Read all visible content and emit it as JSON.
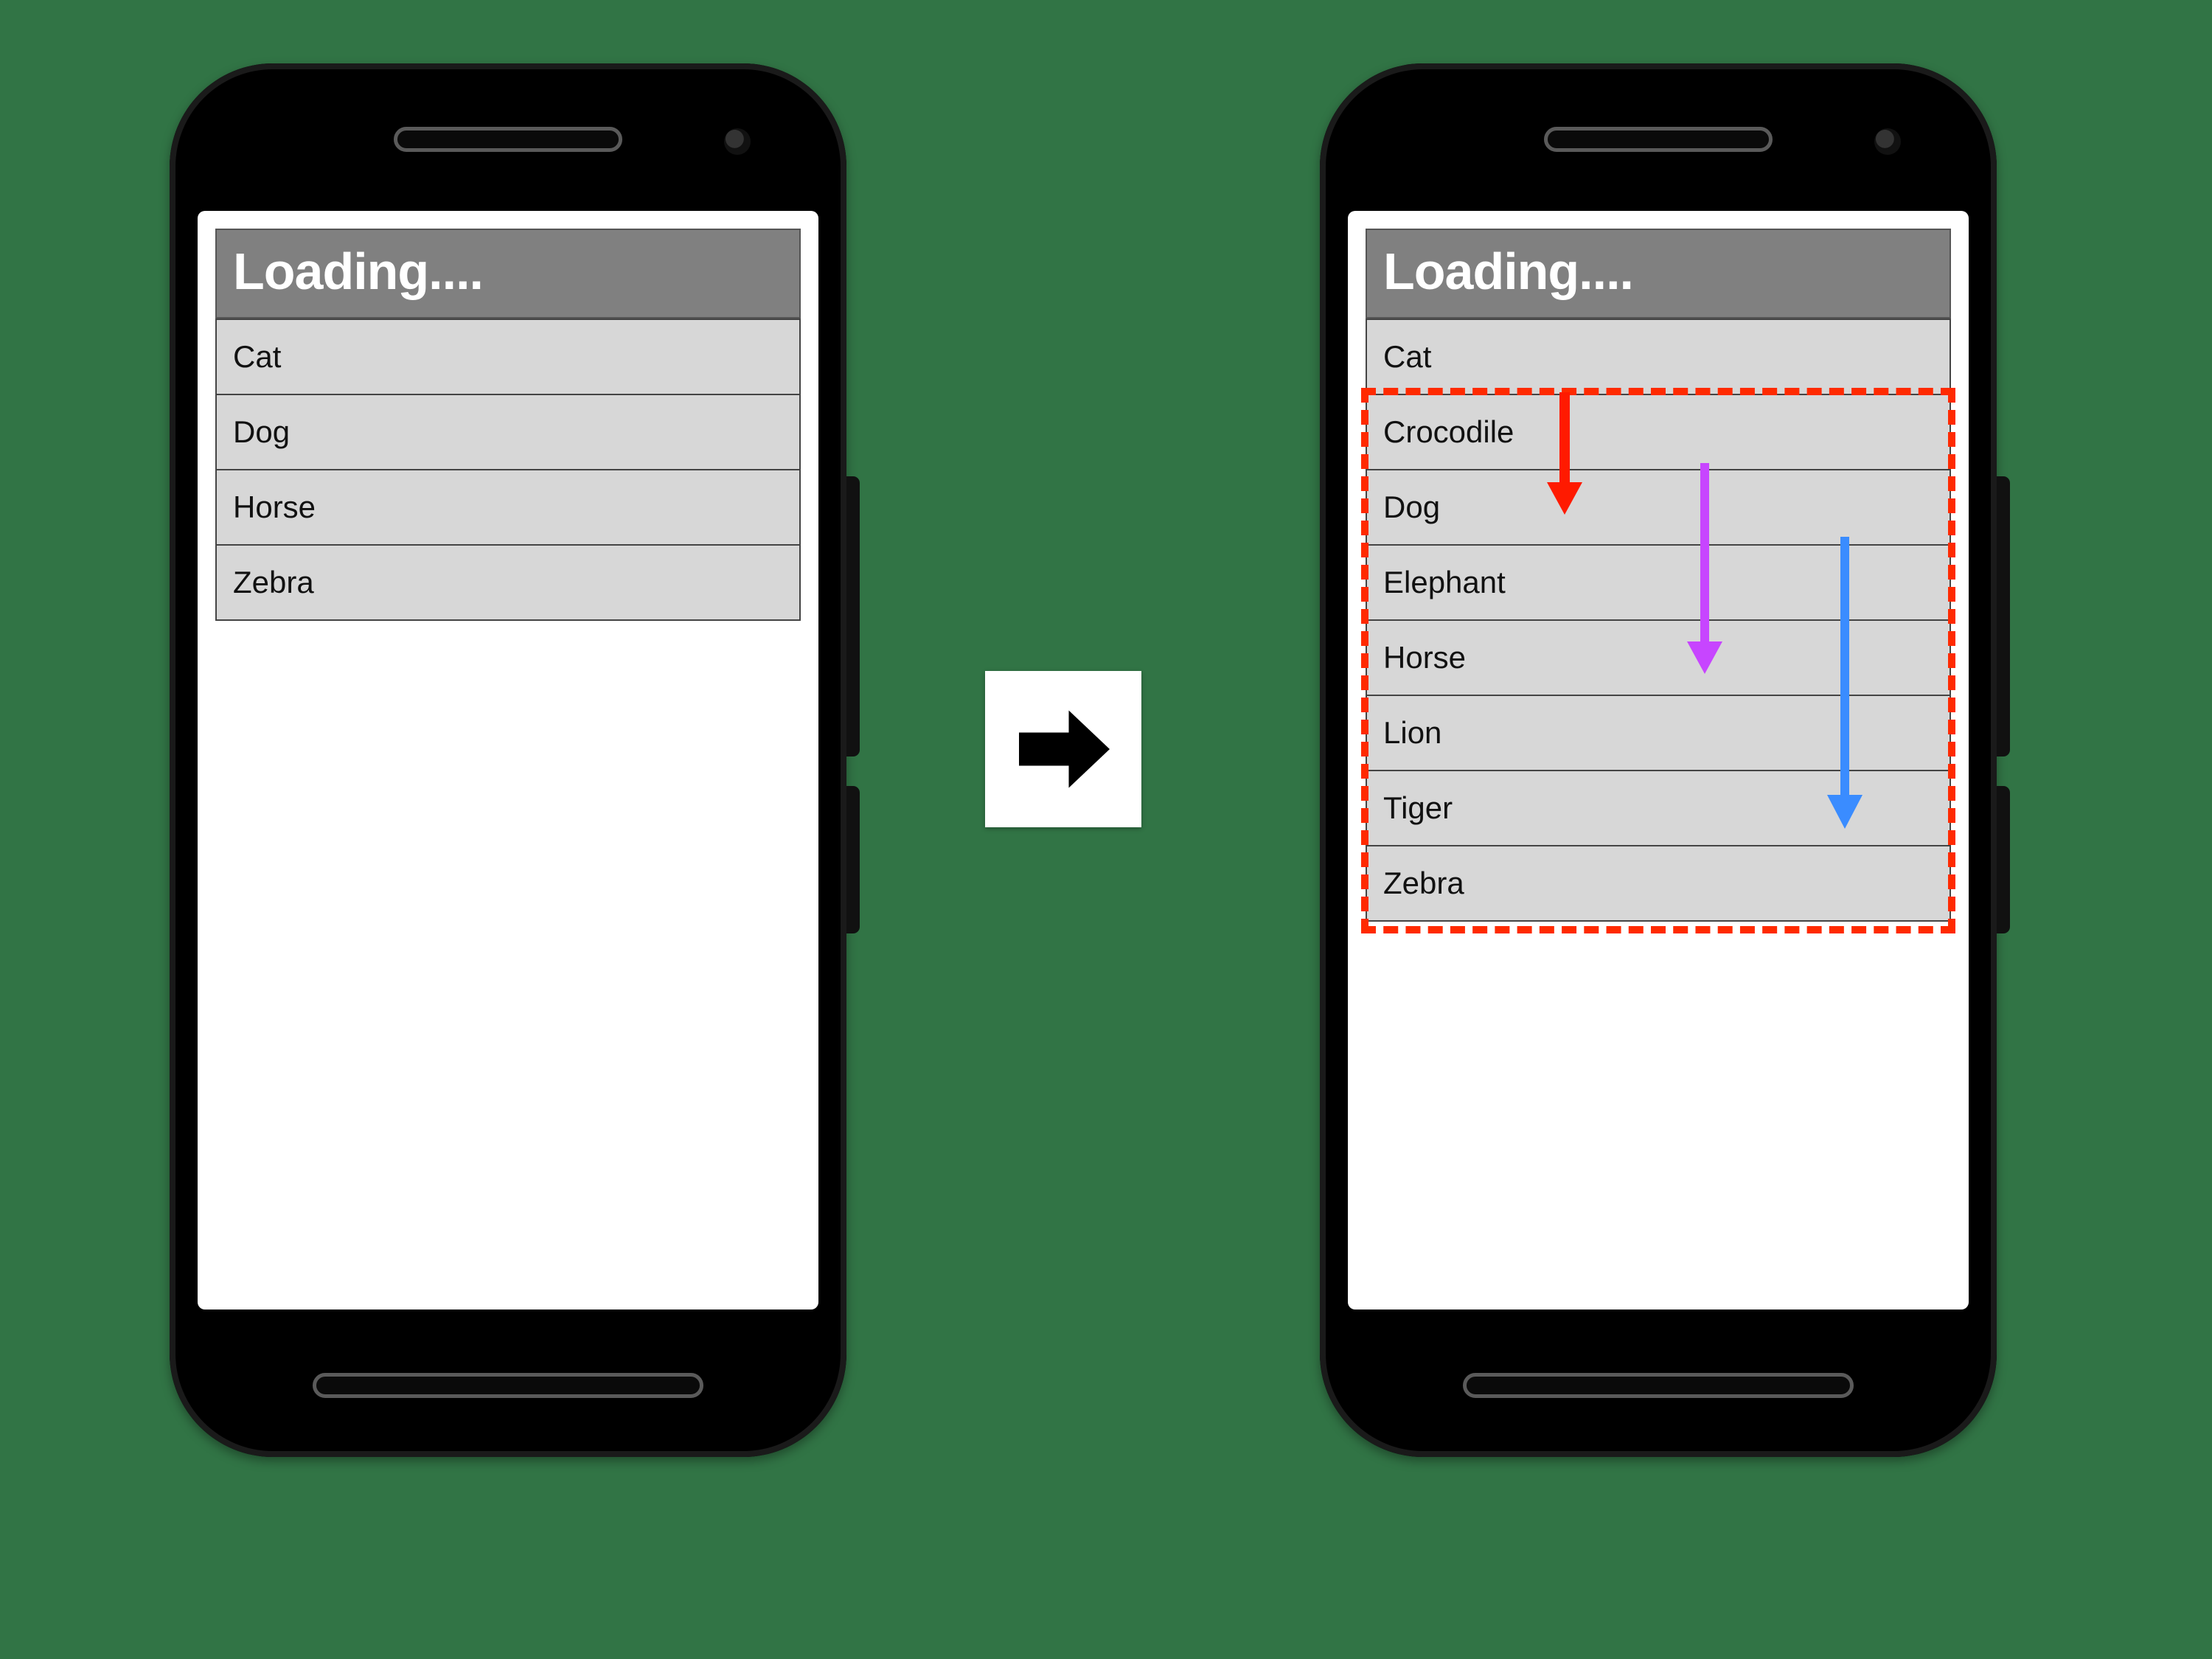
{
  "title": "Loading....",
  "left_phone": {
    "items": [
      "Cat",
      "Dog",
      "Horse",
      "Zebra"
    ]
  },
  "right_phone": {
    "items": [
      "Cat",
      "Crocodile",
      "Dog",
      "Elephant",
      "Horse",
      "Lion",
      "Tiger",
      "Zebra"
    ]
  },
  "arrows": {
    "red": {
      "color": "#ff1a00"
    },
    "purple": {
      "color": "#c745ff"
    },
    "blue": {
      "color": "#3a8cff"
    }
  },
  "colors": {
    "background": "#317445",
    "titlebar": "#808080",
    "row": "#d7d7d7",
    "highlight": "#ff2a00"
  }
}
